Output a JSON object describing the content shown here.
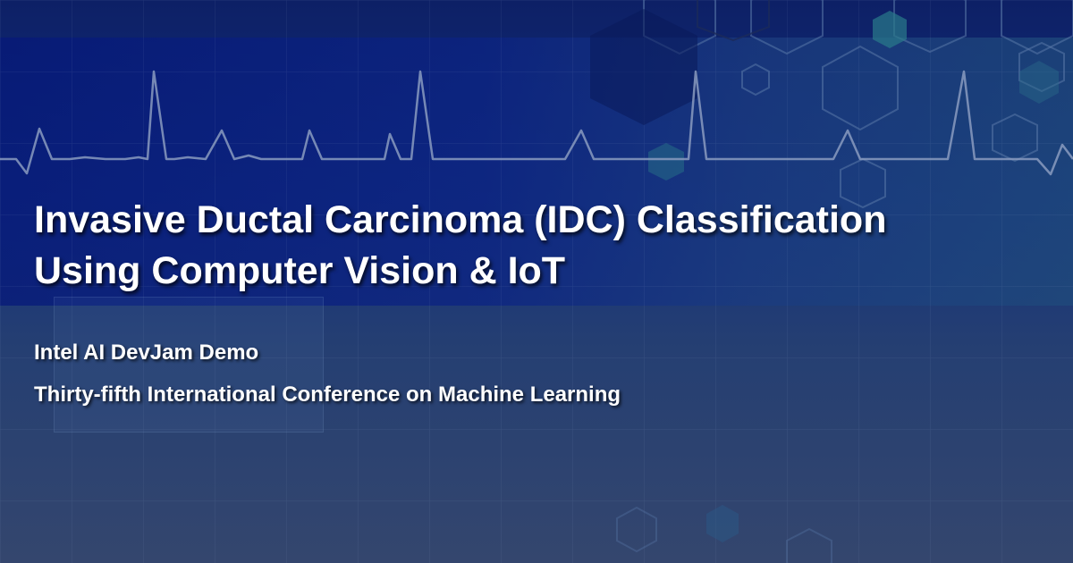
{
  "banner": {
    "title_line_1": "Invasive Ductal Carcinoma (IDC) Classification",
    "title_line_2": "Using Computer Vision & IoT",
    "subtitle": "Intel AI DevJam Demo",
    "event": "Thirty-fifth International Conference on Machine Learning"
  },
  "theme": {
    "background_top": "#0d2066",
    "background_bottom": "#34466e",
    "band": "#0b2383",
    "heartbeat_line": "#8a9bc0",
    "hexagon_outline": "#5a78a8",
    "hexagon_fill": "#2a6a8a",
    "text": "#ffffff"
  },
  "decorations": {
    "background_pattern": "grid",
    "heartbeat": "ecg-waveform-line",
    "shapes": "hexagons"
  }
}
